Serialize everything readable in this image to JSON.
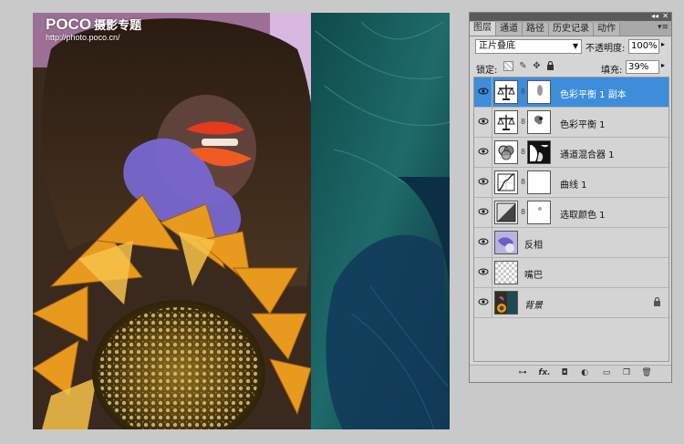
{
  "watermark": {
    "brand": "POCO",
    "brand_cn": "摄影专题",
    "url": "http://photo.poco.cn/"
  },
  "panel": {
    "collapse_glyph": "◂◂",
    "close_glyph": "✕",
    "tabs": [
      {
        "label": "图层",
        "active": true
      },
      {
        "label": "通道",
        "active": false
      },
      {
        "label": "路径",
        "active": false
      },
      {
        "label": "历史记录",
        "active": false
      },
      {
        "label": "动作",
        "active": false
      }
    ],
    "menu_icon": "panel-menu-icon",
    "blend_mode": "正片叠底",
    "opacity_label": "不透明度:",
    "opacity_value": "100%",
    "lock_label": "锁定:",
    "fill_label": "填充:",
    "fill_value": "39%",
    "layers": [
      {
        "name": "色彩平衡 1 副本",
        "type": "color-balance",
        "selected": true,
        "mask": "mask-light",
        "visible": true
      },
      {
        "name": "色彩平衡 1",
        "type": "color-balance",
        "selected": false,
        "mask": "mask-face",
        "visible": true
      },
      {
        "name": "通道混合器 1",
        "type": "channel-mixer",
        "selected": false,
        "mask": "mask-dark",
        "visible": true
      },
      {
        "name": "曲线 1",
        "type": "curves",
        "selected": false,
        "mask": "mask-white",
        "visible": true
      },
      {
        "name": "选取颜色 1",
        "type": "selective-color",
        "selected": false,
        "mask": "mask-white",
        "visible": true
      },
      {
        "name": "反相",
        "type": "pixel-invert",
        "selected": false,
        "visible": true
      },
      {
        "name": "嘴巴",
        "type": "pixel-transparent",
        "selected": false,
        "visible": true
      },
      {
        "name": "背景",
        "type": "background",
        "selected": false,
        "visible": true,
        "locked": true
      }
    ],
    "footer_icons": [
      "link-layers-icon",
      "fx-icon",
      "add-mask-icon",
      "adjustment-layer-icon",
      "new-group-icon",
      "new-layer-icon",
      "trash-icon"
    ],
    "footer_fx_label": "fx."
  },
  "colors": {
    "selection_blue": "#3d8ddb",
    "panel_bg": "#d6d6d6",
    "app_bg": "#c9c9c9"
  }
}
